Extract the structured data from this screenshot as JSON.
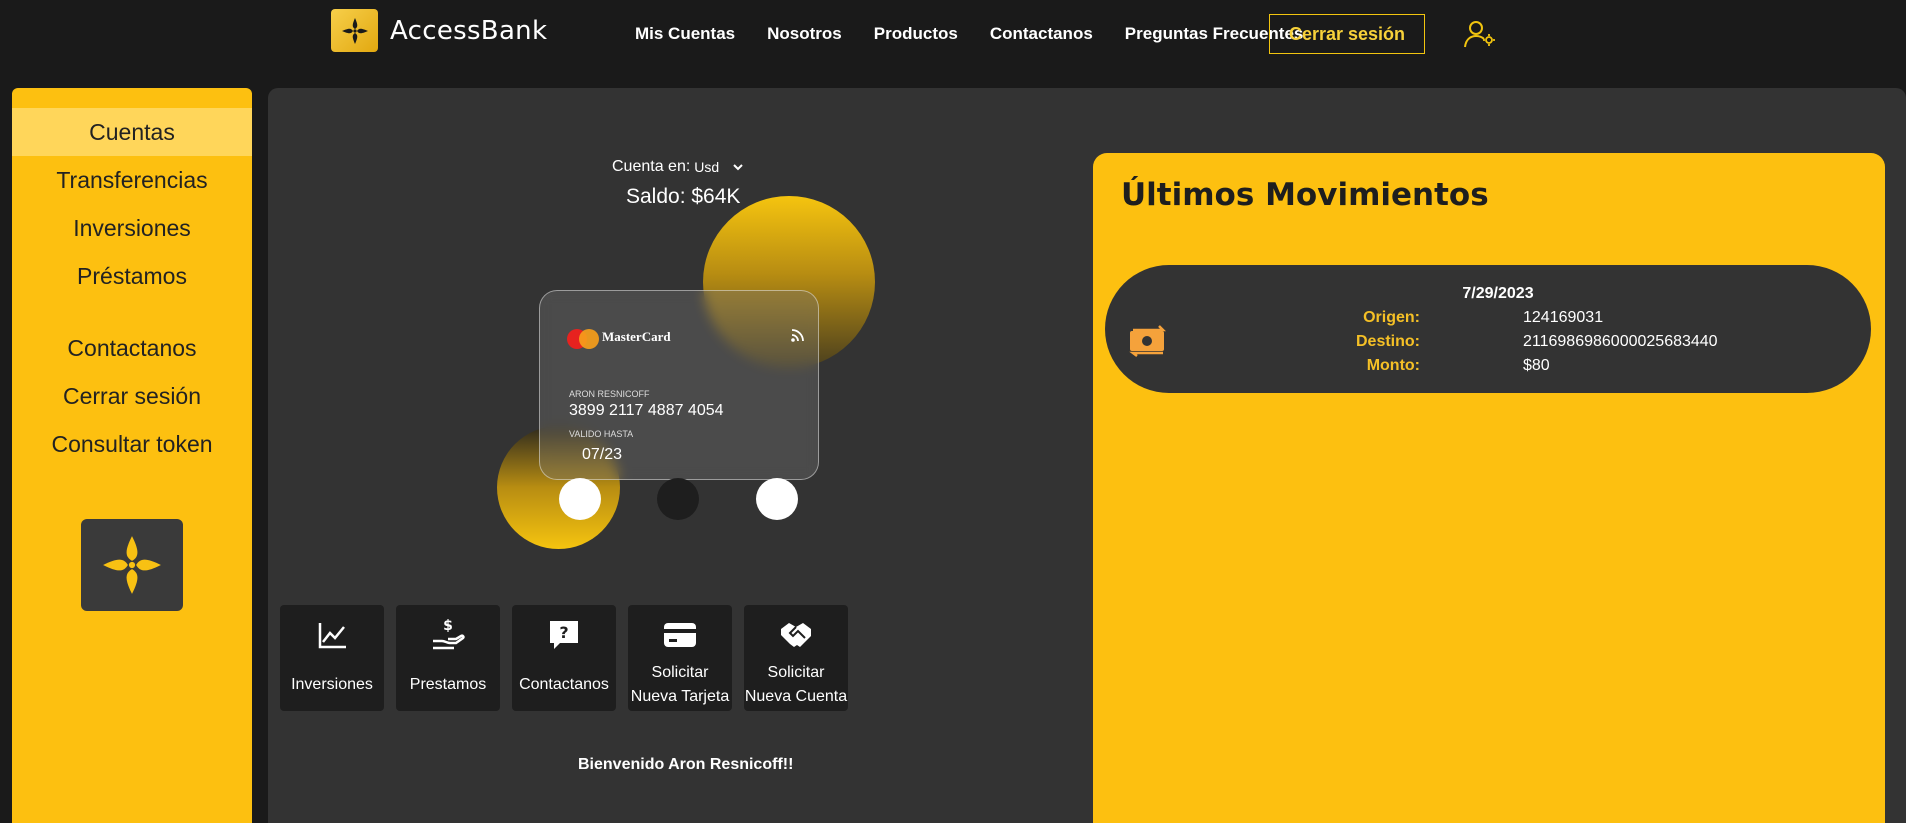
{
  "brand": {
    "name": "AccessBank"
  },
  "nav": {
    "links": [
      "Mis Cuentas",
      "Nosotros",
      "Productos",
      "Contactanos",
      "Preguntas Frecuentes"
    ],
    "logout_label": "Cerrar sesión"
  },
  "sidebar": {
    "items": [
      "Cuentas",
      "Transferencias",
      "Inversiones",
      "Préstamos",
      "Contactanos",
      "Cerrar sesión",
      "Consultar token"
    ]
  },
  "account": {
    "label": "Cuenta en:",
    "currency": "Usd",
    "balance": "Saldo: $64K"
  },
  "card": {
    "brand": "MasterCard",
    "holder": "ARON RESNICOFF",
    "number": "3899 2117 4887 4054",
    "valid_label": "VALIDO HASTA",
    "valid_value": "07/23"
  },
  "quick_actions": [
    {
      "line1": "Inversiones",
      "line2": ""
    },
    {
      "line1": "Prestamos",
      "line2": ""
    },
    {
      "line1": "Contactanos",
      "line2": ""
    },
    {
      "line1": "Solicitar",
      "line2": "Nueva Tarjeta"
    },
    {
      "line1": "Solicitar",
      "line2": "Nueva Cuenta"
    }
  ],
  "welcome": "Bienvenido Aron Resnicoff!!",
  "movements": {
    "title": "Últimos Movimientos",
    "items": [
      {
        "date": "7/29/2023",
        "origin_label": "Origen:",
        "origin": "124169031",
        "dest_label": "Destino:",
        "dest": "2116986986000025683440",
        "amount_label": "Monto:",
        "amount": "$80"
      }
    ]
  },
  "colors": {
    "accent": "#fdc010",
    "panel": "#333333",
    "background": "#1a1a1a"
  }
}
